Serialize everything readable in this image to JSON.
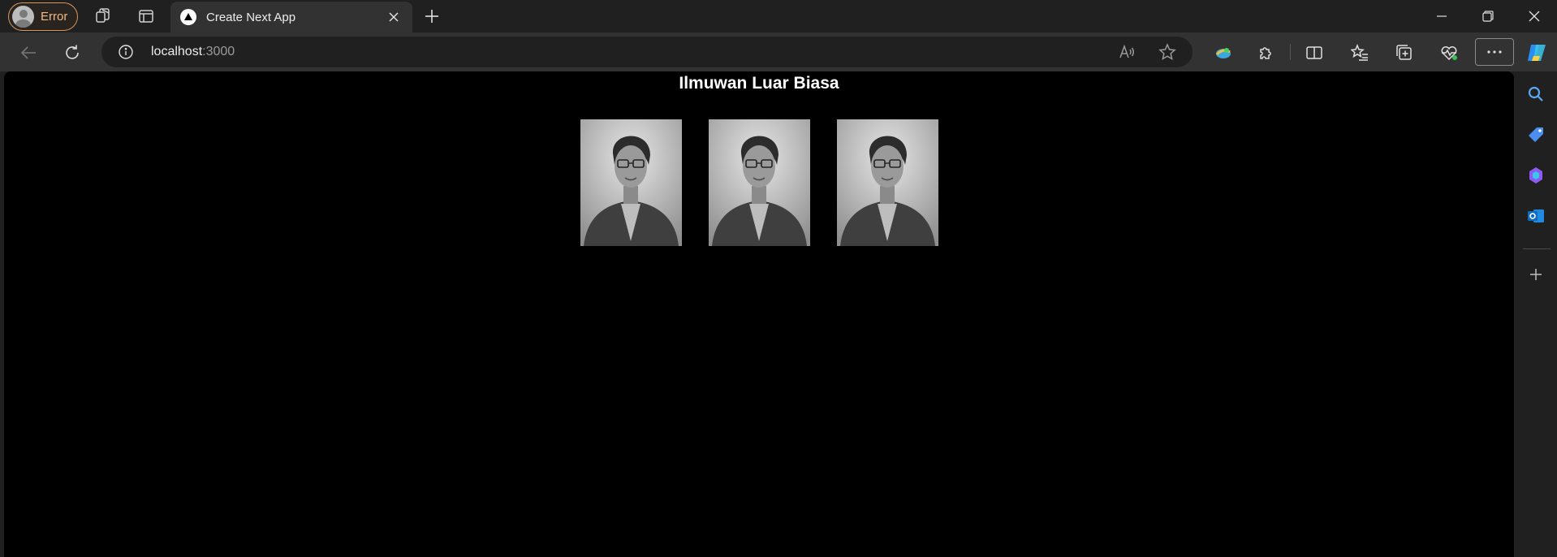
{
  "profile": {
    "label": "Error",
    "icon": "user-avatar-icon",
    "accent": "#d8955a"
  },
  "tab": {
    "title": "Create Next App",
    "favicon": "nextjs-triangle-icon"
  },
  "address_bar": {
    "host": "localhost",
    "port": ":3000"
  },
  "page": {
    "title": "Ilmuwan Luar Biasa",
    "photos": [
      {
        "subject": "scientist-portrait"
      },
      {
        "subject": "scientist-portrait"
      },
      {
        "subject": "scientist-portrait"
      }
    ],
    "background": "#000000",
    "text_color": "#ffffff"
  },
  "colors": {
    "chrome_dark": "#202020",
    "chrome_tab": "#323232"
  }
}
